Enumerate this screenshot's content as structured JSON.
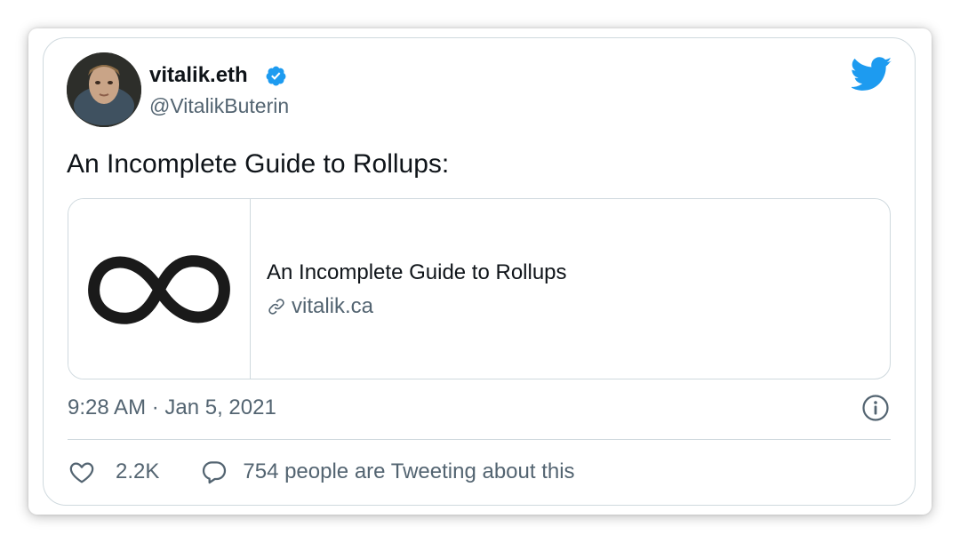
{
  "author": {
    "display_name": "vitalik.eth",
    "handle": "@VitalikButerin",
    "verified": true
  },
  "tweet": {
    "text": "An Incomplete Guide to Rollups:",
    "timestamp": "9:28 AM · Jan 5, 2021"
  },
  "link_card": {
    "title": "An Incomplete Guide to Rollups",
    "domain": "vitalik.ca",
    "thumbnail_icon": "infinity-icon"
  },
  "actions": {
    "likes": "2.2K",
    "replies_label": "754 people are Tweeting about this"
  },
  "icons": {
    "verified": "verified-badge-icon",
    "logo": "twitter-bird-icon",
    "link": "link-icon",
    "info": "info-icon",
    "like": "heart-icon",
    "reply": "speech-bubble-icon"
  },
  "colors": {
    "twitter_blue": "#1d9bf0",
    "text_primary": "#0f1419",
    "text_secondary": "#536471",
    "border": "#cfd9de"
  }
}
